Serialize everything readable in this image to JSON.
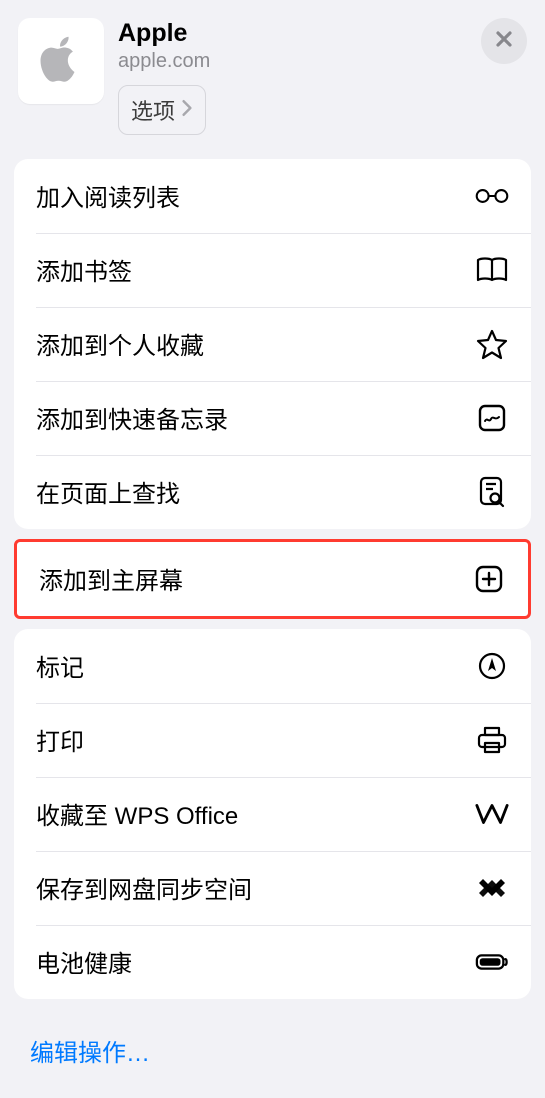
{
  "header": {
    "title": "Apple",
    "subtitle": "apple.com",
    "options_label": "选项"
  },
  "groups": [
    {
      "rows": [
        {
          "label": "加入阅读列表",
          "icon": "glasses-icon"
        },
        {
          "label": "添加书签",
          "icon": "book-icon"
        },
        {
          "label": "添加到个人收藏",
          "icon": "star-icon"
        },
        {
          "label": "添加到快速备忘录",
          "icon": "quicknote-icon"
        },
        {
          "label": "在页面上查找",
          "icon": "find-on-page-icon"
        }
      ]
    },
    {
      "highlighted": true,
      "rows": [
        {
          "label": "添加到主屏幕",
          "icon": "add-to-home-icon"
        }
      ]
    },
    {
      "rows": [
        {
          "label": "标记",
          "icon": "markup-icon"
        },
        {
          "label": "打印",
          "icon": "print-icon"
        },
        {
          "label": "收藏至 WPS Office",
          "icon": "wps-icon"
        },
        {
          "label": "保存到网盘同步空间",
          "icon": "sync-icon"
        },
        {
          "label": "电池健康",
          "icon": "battery-icon"
        }
      ]
    }
  ],
  "footer": {
    "edit_label": "编辑操作…"
  }
}
